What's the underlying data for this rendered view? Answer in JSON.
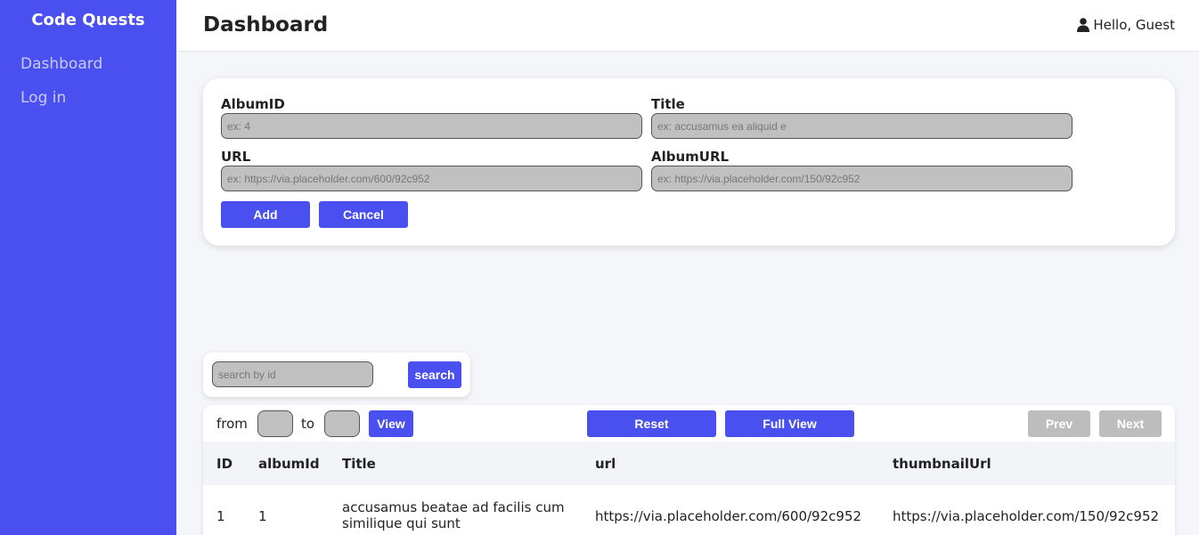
{
  "sidebar": {
    "brand": "Code Quests",
    "items": [
      {
        "label": "Dashboard"
      },
      {
        "label": "Log in"
      }
    ]
  },
  "header": {
    "title": "Dashboard",
    "greeting": "Hello, Guest",
    "user_icon": "user-icon"
  },
  "form": {
    "albumid_label": "AlbumID",
    "albumid_placeholder": "ex: 4",
    "title_label": "Title",
    "title_placeholder": "ex: accusamus ea aliquid e",
    "url_label": "URL",
    "url_placeholder": "ex: https://via.placeholder.com/600/92c952",
    "albumurl_label": "AlbumURL",
    "albumurl_placeholder": "ex: https://via.placeholder.com/150/92c952",
    "add_label": "Add",
    "cancel_label": "Cancel"
  },
  "search": {
    "placeholder": "search by id",
    "button_label": "search"
  },
  "range": {
    "from_label": "from",
    "to_label": "to",
    "view_label": "View",
    "reset_label": "Reset",
    "full_view_label": "Full View",
    "prev_label": "Prev",
    "next_label": "Next"
  },
  "table": {
    "headers": [
      "ID",
      "albumId",
      "Title",
      "url",
      "thumbnailUrl"
    ],
    "rows": [
      [
        "1",
        "1",
        "accusamus beatae ad facilis cum similique qui sunt",
        "https://via.placeholder.com/600/92c952",
        "https://via.placeholder.com/150/92c952"
      ]
    ]
  },
  "colors": {
    "accent": "#4a4ff0",
    "input_bg": "#c0c0c0",
    "disabled": "#bdbdbd"
  }
}
